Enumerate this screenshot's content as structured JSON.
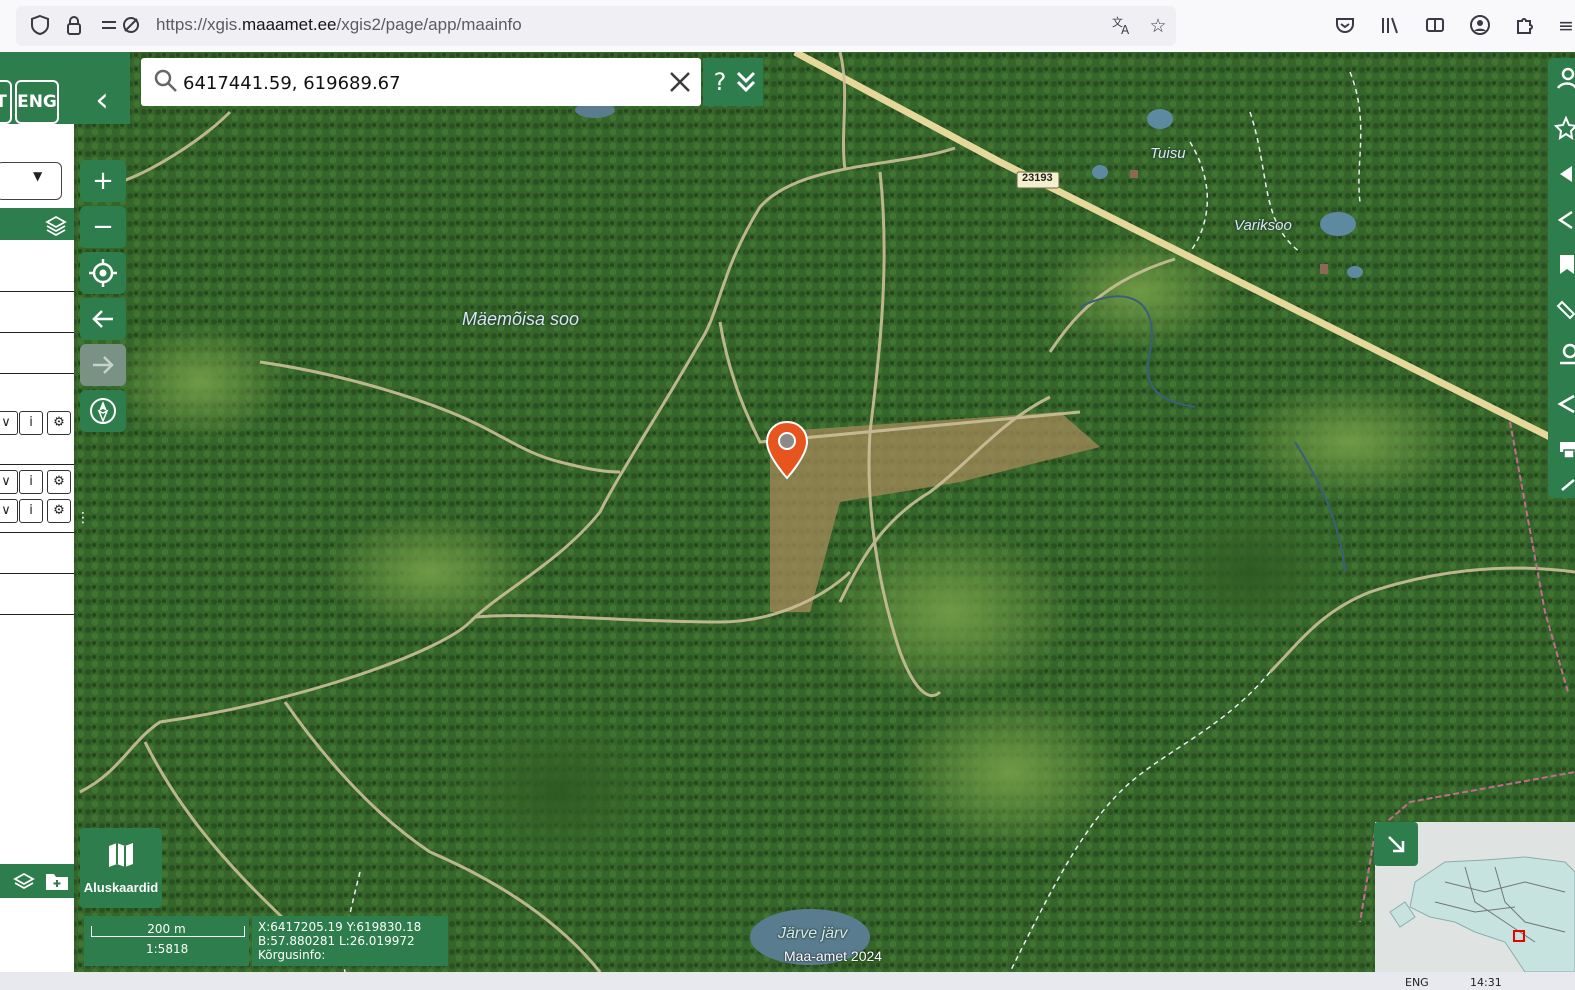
{
  "browser": {
    "url_prefix": "https://xgis.",
    "url_domain": "maaamet.ee",
    "url_path": "/xgis2/page/app/maainfo",
    "icons": [
      "shield-icon",
      "lock-icon",
      "permissions-icon",
      "translate-icon",
      "bookmark-star-icon",
      "pocket-icon",
      "library-icon",
      "reader-icon",
      "account-icon",
      "extensions-icon"
    ]
  },
  "language": {
    "other_label": "T",
    "current_label": "ENG"
  },
  "search": {
    "value": "6417441.59, 619689.67",
    "help_label": "?"
  },
  "map": {
    "labels": {
      "maemoisa": "Mäemõisa soo",
      "tuisu": "Tuisu",
      "variksoo": "Variksoo",
      "jarve": "Järve järv",
      "road": "23193"
    },
    "attribution": "Maa-amet 2024"
  },
  "controls": {
    "zoom_in": "+",
    "zoom_out": "−",
    "basemaps_label": "Aluskaardid"
  },
  "scale": {
    "distance": "200 m",
    "ratio": "1:5818"
  },
  "coords": {
    "xy": "X:6417205.19 Y:619830.18",
    "bl": "B:57.880281 L:26.019972",
    "height": "Kõrgusinfo:"
  },
  "taskbar": {
    "lang": "ENG",
    "time": "14:31"
  },
  "colors": {
    "accent": "#2e7d4c",
    "marker": "#e8541e"
  }
}
